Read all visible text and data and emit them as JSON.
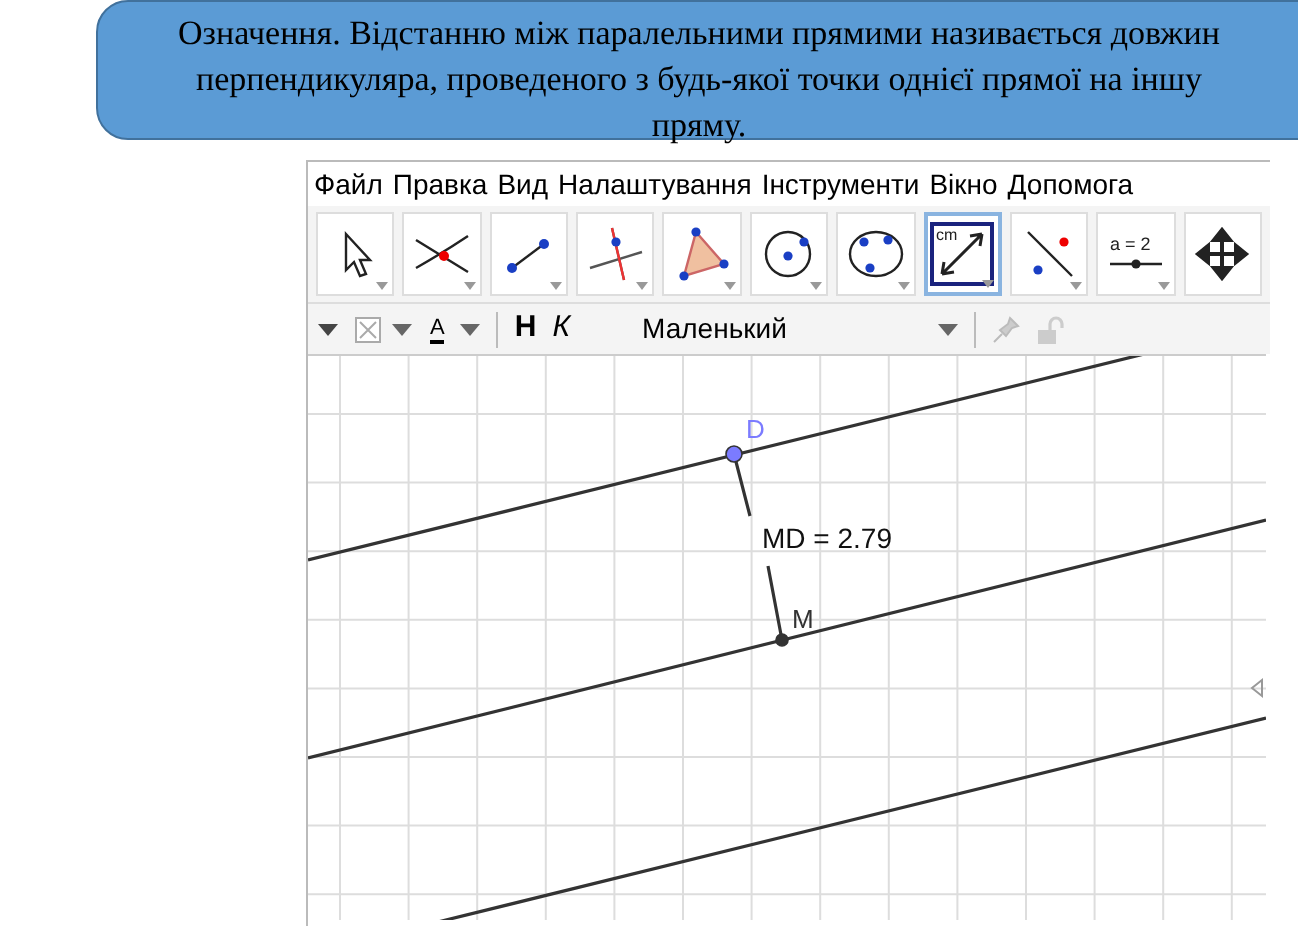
{
  "definition": {
    "lines": [
      "Означення. Відстанню між паралельними прямими називається довжин",
      "перпендикуляра, проведеного з будь-якої точки однієї прямої на іншу",
      "пряму."
    ]
  },
  "menu": [
    "Файл",
    "Правка",
    "Вид",
    "Налаштування",
    "Інструменти",
    "Вікно",
    "Допомога"
  ],
  "tools": [
    {
      "kind": "move",
      "selected": false
    },
    {
      "kind": "intersect",
      "selected": false
    },
    {
      "kind": "segment",
      "selected": false
    },
    {
      "kind": "perpendicular",
      "selected": false
    },
    {
      "kind": "polygon",
      "selected": false
    },
    {
      "kind": "circle",
      "selected": false
    },
    {
      "kind": "conic",
      "selected": false
    },
    {
      "kind": "distance",
      "selected": true,
      "label": "cm"
    },
    {
      "kind": "reflect",
      "selected": false
    },
    {
      "kind": "slider",
      "selected": false,
      "label": "a = 2"
    },
    {
      "kind": "pan",
      "selected": false
    }
  ],
  "style_bar": {
    "text_color_label": "A",
    "bold": "Н",
    "italic": "К",
    "size": "Маленький"
  },
  "canvas": {
    "points": [
      {
        "label": "D",
        "color": "#7b7bff"
      },
      {
        "label": "M",
        "color": "#333333"
      }
    ],
    "measurement": "MD = 2.79"
  }
}
